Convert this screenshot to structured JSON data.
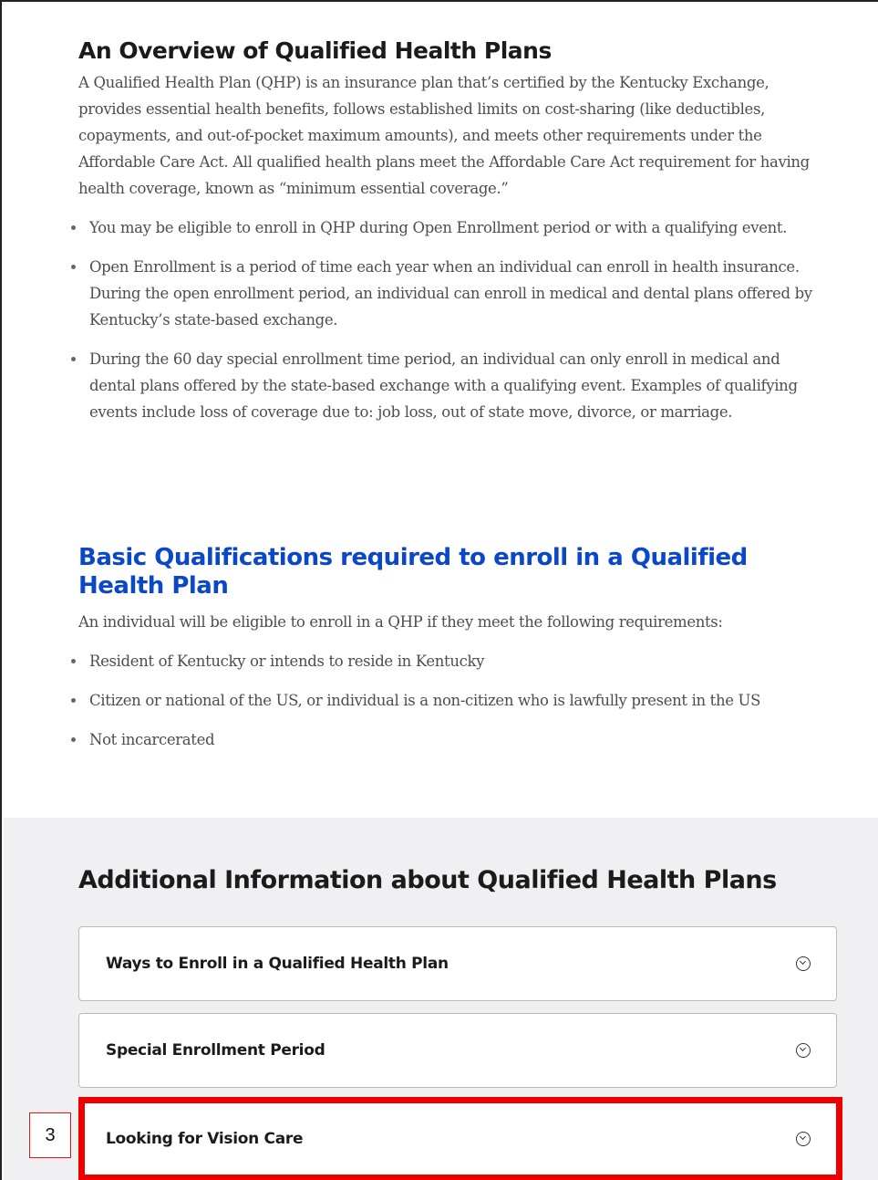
{
  "overview": {
    "title": "An Overview of Qualified Health Plans",
    "paragraph": "A Qualified Health Plan (QHP) is an insurance plan that’s certified by the Kentucky Exchange, provides essential health benefits, follows established limits on cost-sharing (like deductibles, copayments, and out-of-pocket maximum amounts), and meets other requirements under the Affordable Care Act. All qualified health plans meet the Affordable Care Act requirement for having health coverage, known as “minimum essential coverage.”",
    "bullets": [
      "You may be eligible to enroll in QHP during Open Enrollment period or with a qualifying event.",
      "Open Enrollment is a period of time each year when an individual can enroll in health insurance. During the open enrollment period, an individual can enroll in medical and dental plans offered by Kentucky’s state-based exchange.",
      "During the 60 day special enrollment time period, an individual can only enroll in medical and dental plans offered by the state-based exchange with a qualifying event. Examples of qualifying events include loss of coverage due to: job loss, out of state move, divorce, or marriage."
    ]
  },
  "qualifications": {
    "title": "Basic Qualifications required to enroll in a Qualified Health Plan",
    "intro": "An individual will be eligible to enroll in a QHP if they meet the following requirements:",
    "bullets": [
      "Resident of Kentucky or intends to reside in Kentucky",
      "Citizen or national of the US, or individual is a non-citizen who is lawfully present in the US",
      "Not incarcerated"
    ]
  },
  "additional": {
    "title": "Additional Information about Qualified Health Plans",
    "accordions": [
      {
        "label": "Ways to Enroll in a Qualified Health Plan",
        "icon": "chevron-down-circle-icon"
      },
      {
        "label": "Special Enrollment Period",
        "icon": "chevron-down-circle-icon"
      },
      {
        "label": "Looking for Vision Care",
        "icon": "chevron-down-circle-icon"
      }
    ]
  },
  "annotation": {
    "callout_number": "3",
    "highlight_color": "#ee0000"
  },
  "colors": {
    "heading_dark": "#1b1b1b",
    "heading_blue": "#0b47c9",
    "body_text": "#4d4d4d",
    "section_bg": "#f0f0f2"
  }
}
